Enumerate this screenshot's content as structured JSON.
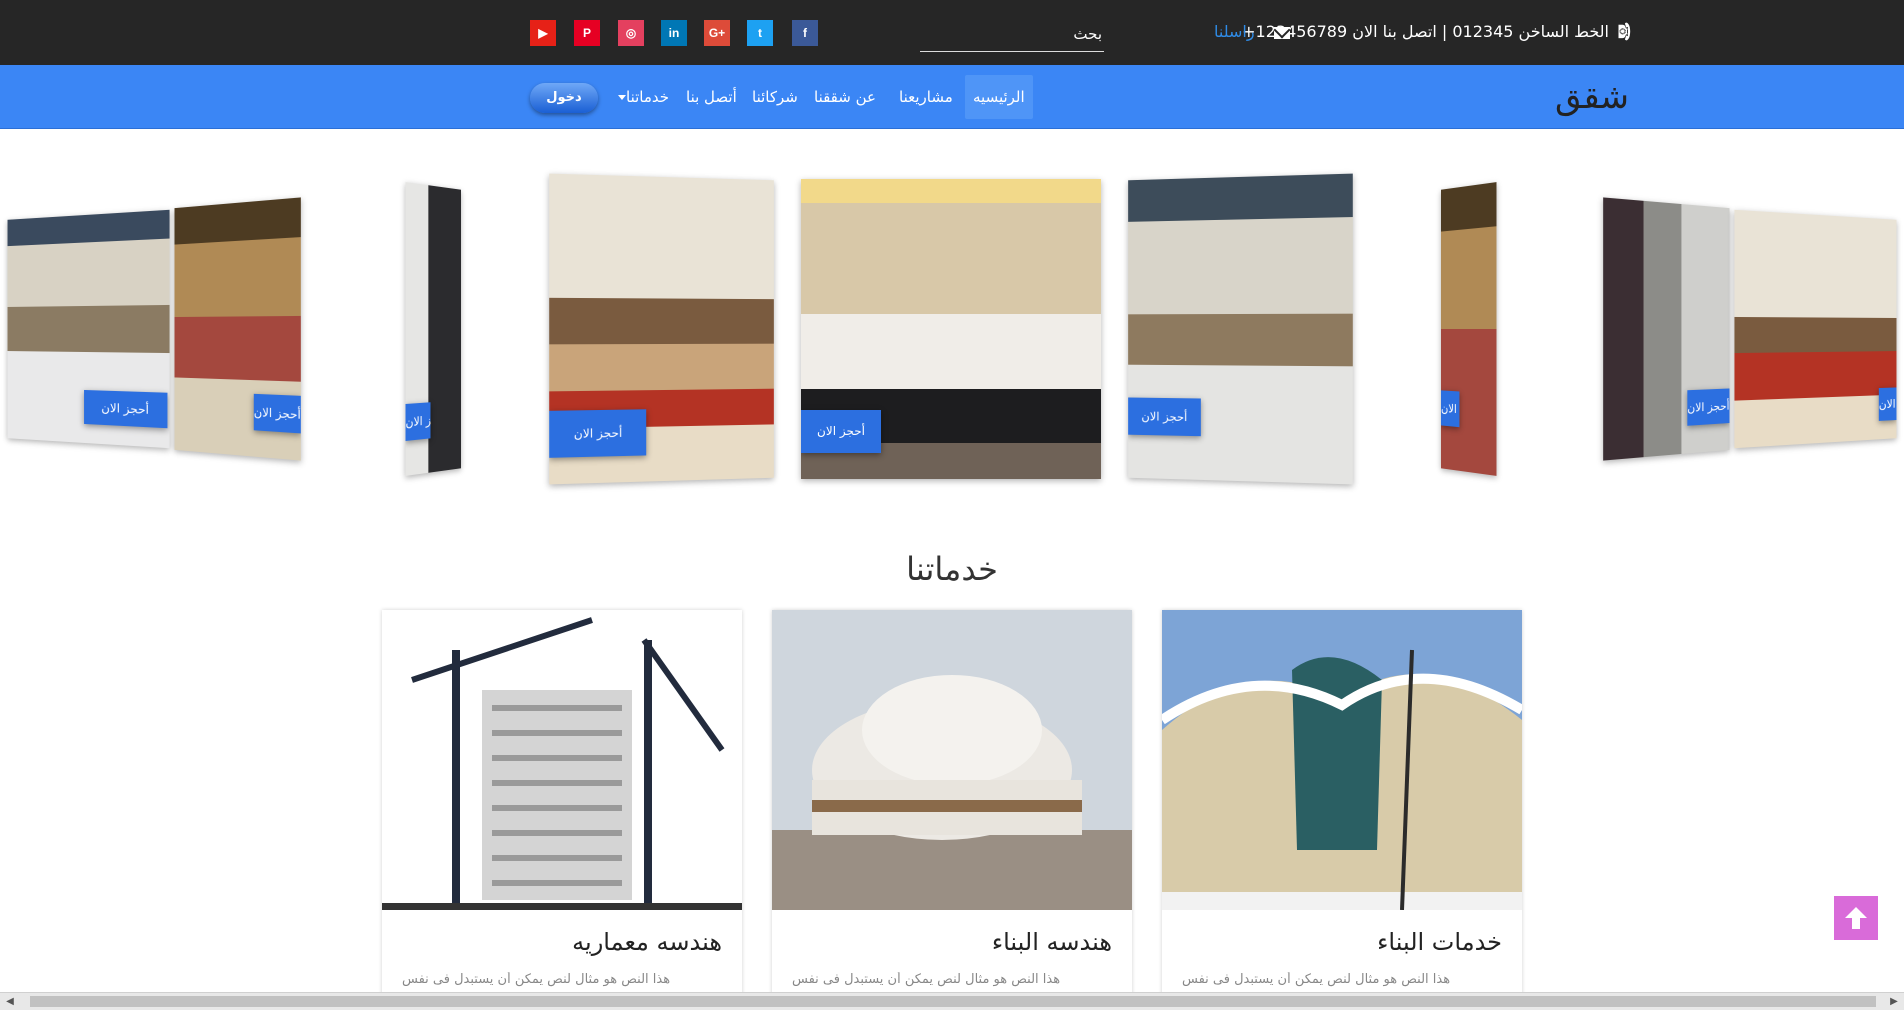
{
  "topbar": {
    "phone_text": "الخط الساخن 012345 | اتصل بنا الان 123456789+",
    "contact_label": "راسلنا",
    "search_placeholder": "بحث",
    "social": [
      {
        "icon": "facebook-icon",
        "glyph": "f",
        "color": "#3b5998"
      },
      {
        "icon": "twitter-icon",
        "glyph": "t",
        "color": "#1da1f2"
      },
      {
        "icon": "google-plus-icon",
        "glyph": "G+",
        "color": "#dd4b39"
      },
      {
        "icon": "linkedin-icon",
        "glyph": "in",
        "color": "#0077b5"
      },
      {
        "icon": "instagram-icon",
        "glyph": "◎",
        "color": "#e4405f"
      },
      {
        "icon": "pinterest-icon",
        "glyph": "P",
        "color": "#e60023"
      },
      {
        "icon": "youtube-icon",
        "glyph": "▶",
        "color": "#e62117"
      }
    ]
  },
  "navbar": {
    "brand": "شقق",
    "items": [
      "الرئيسيه",
      "مشاريعنا",
      "عن شققنا",
      "شركائنا",
      "أتصل بنا",
      "خدماتنا"
    ],
    "login": "دخول"
  },
  "carousel": {
    "book_label": "أحجز الان"
  },
  "services": {
    "title": "خدماتنا",
    "cards": [
      {
        "title": "هندسه معماريه",
        "text": "هذا النص هو مثال لنص يمكن أن يستبدل فى نفس"
      },
      {
        "title": "هندسه البناء",
        "text": "هذا النص هو مثال لنص يمكن أن يستبدل فى نفس"
      },
      {
        "title": "خدمات البناء",
        "text": "هذا النص هو مثال لنص يمكن أن يستبدل فى نفس"
      }
    ]
  },
  "colors": {
    "topbar": "#262626",
    "navbar": "#3b86f5",
    "accent": "#2c6fe0",
    "up_button": "#d96bd9"
  }
}
